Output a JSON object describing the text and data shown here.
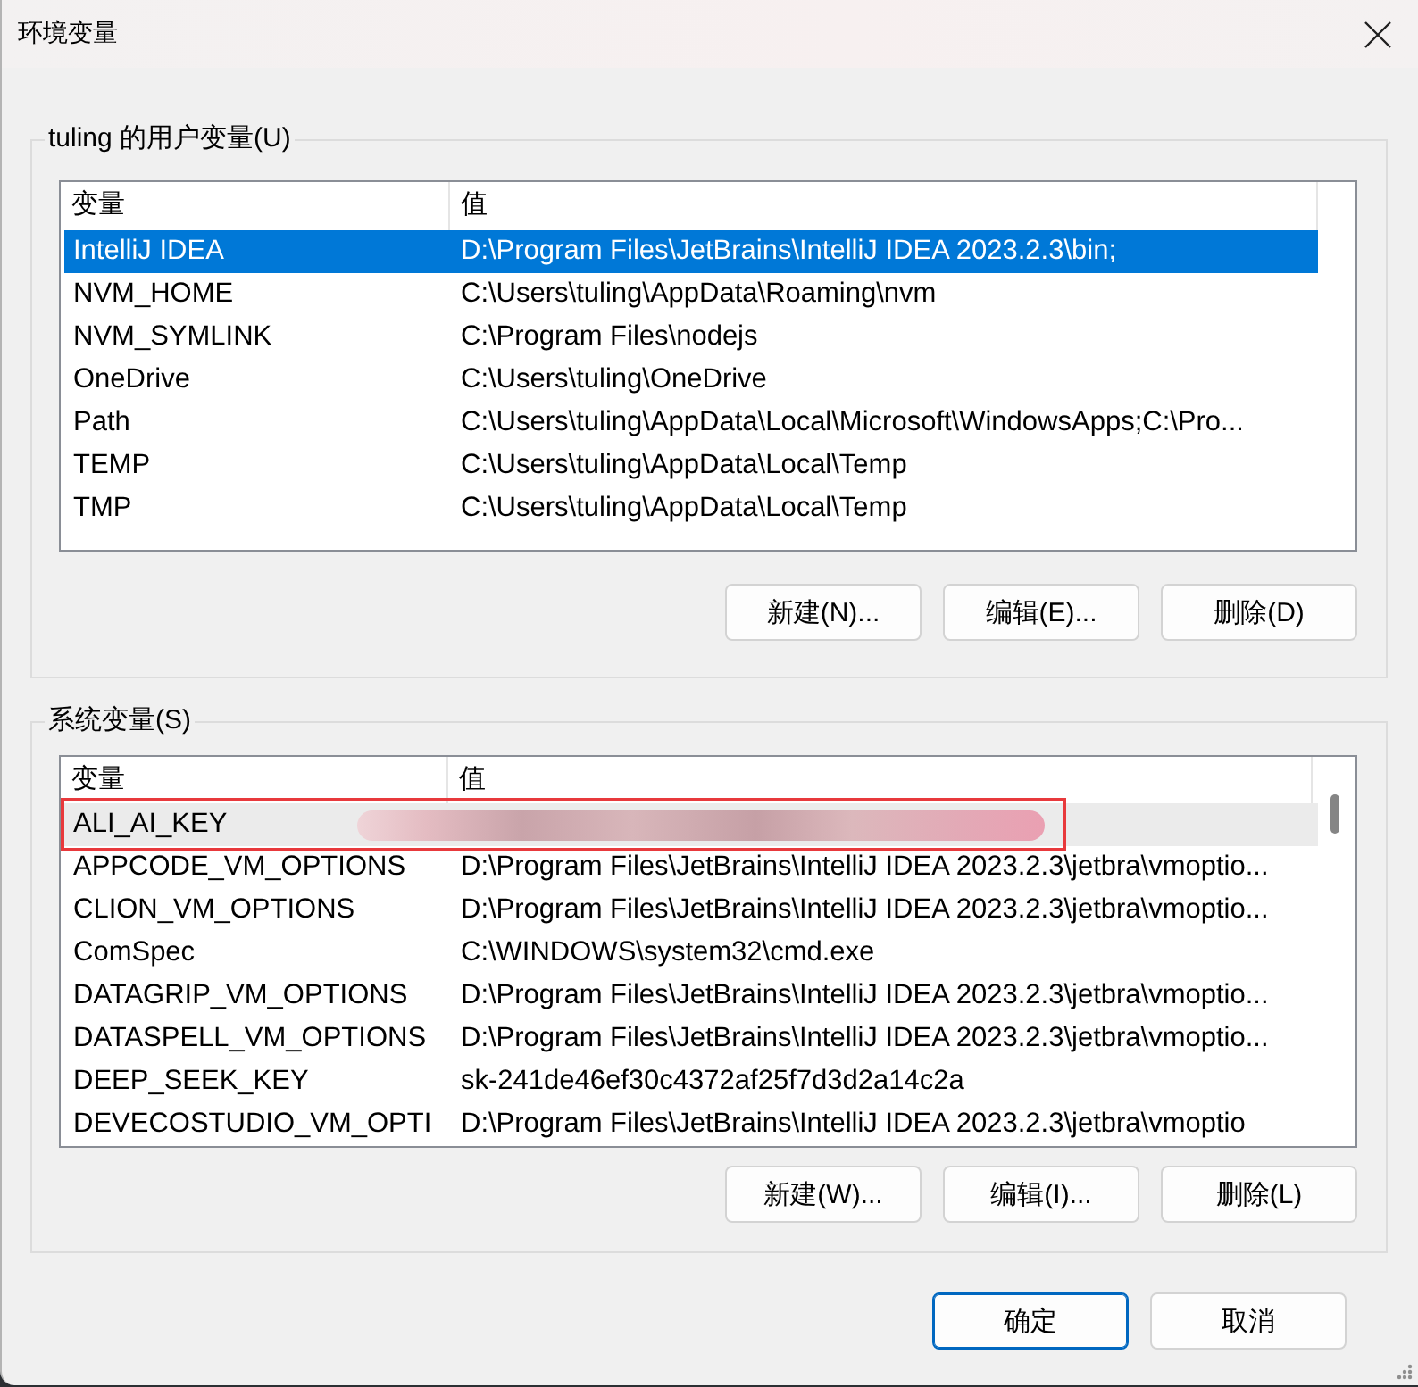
{
  "window": {
    "title": "环境变量"
  },
  "user_variables": {
    "title": "tuling 的用户变量(U)",
    "focused": true,
    "scrollbar": false,
    "columns": [
      "变量",
      "值"
    ],
    "rows": [
      {
        "name": "IntelliJ IDEA",
        "value": "D:\\Program Files\\JetBrains\\IntelliJ IDEA 2023.2.3\\bin;",
        "selected": true
      },
      {
        "name": "NVM_HOME",
        "value": "C:\\Users\\tuling\\AppData\\Roaming\\nvm",
        "selected": false
      },
      {
        "name": "NVM_SYMLINK",
        "value": "C:\\Program Files\\nodejs",
        "selected": false
      },
      {
        "name": "OneDrive",
        "value": "C:\\Users\\tuling\\OneDrive",
        "selected": false
      },
      {
        "name": "Path",
        "value": "C:\\Users\\tuling\\AppData\\Local\\Microsoft\\WindowsApps;C:\\Pro...",
        "selected": false
      },
      {
        "name": "TEMP",
        "value": "C:\\Users\\tuling\\AppData\\Local\\Temp",
        "selected": false
      },
      {
        "name": "TMP",
        "value": "C:\\Users\\tuling\\AppData\\Local\\Temp",
        "selected": false
      }
    ],
    "buttons": [
      "新建(N)...",
      "编辑(E)...",
      "删除(D)"
    ]
  },
  "system_variables": {
    "title": "系统变量(S)",
    "focused": false,
    "scrollbar": true,
    "columns": [
      "变量",
      "值"
    ],
    "rows": [
      {
        "name": "ALI_AI_KEY",
        "selected": true,
        "redacted": true,
        "highlighted": true
      },
      {
        "name": "APPCODE_VM_OPTIONS",
        "value": "D:\\Program Files\\JetBrains\\IntelliJ IDEA 2023.2.3\\jetbra\\vmoptio...",
        "selected": false,
        "redacted": false,
        "highlighted": false
      },
      {
        "name": "CLION_VM_OPTIONS",
        "value": "D:\\Program Files\\JetBrains\\IntelliJ IDEA 2023.2.3\\jetbra\\vmoptio...",
        "selected": false,
        "redacted": false,
        "highlighted": false
      },
      {
        "name": "ComSpec",
        "value": "C:\\WINDOWS\\system32\\cmd.exe",
        "selected": false,
        "redacted": false,
        "highlighted": false
      },
      {
        "name": "DATAGRIP_VM_OPTIONS",
        "value": "D:\\Program Files\\JetBrains\\IntelliJ IDEA 2023.2.3\\jetbra\\vmoptio...",
        "selected": false,
        "redacted": false,
        "highlighted": false
      },
      {
        "name": "DATASPELL_VM_OPTIONS",
        "value": "D:\\Program Files\\JetBrains\\IntelliJ IDEA 2023.2.3\\jetbra\\vmoptio...",
        "selected": false,
        "redacted": false,
        "highlighted": false
      },
      {
        "name": "DEEP_SEEK_KEY",
        "value": "sk-241de46ef30c4372af25f7d3d2a14c2a",
        "selected": false,
        "redacted": false,
        "highlighted": false
      },
      {
        "name": "DEVECOSTUDIO_VM_OPTI",
        "value": "D:\\Program Files\\JetBrains\\IntelliJ IDEA 2023.2.3\\jetbra\\vmoptio",
        "selected": false,
        "redacted": false,
        "highlighted": false
      }
    ],
    "buttons": [
      "新建(W)...",
      "编辑(I)...",
      "删除(L)"
    ]
  },
  "dialog_buttons": [
    {
      "label": "确定",
      "default": true
    },
    {
      "label": "取消",
      "default": false
    }
  ]
}
